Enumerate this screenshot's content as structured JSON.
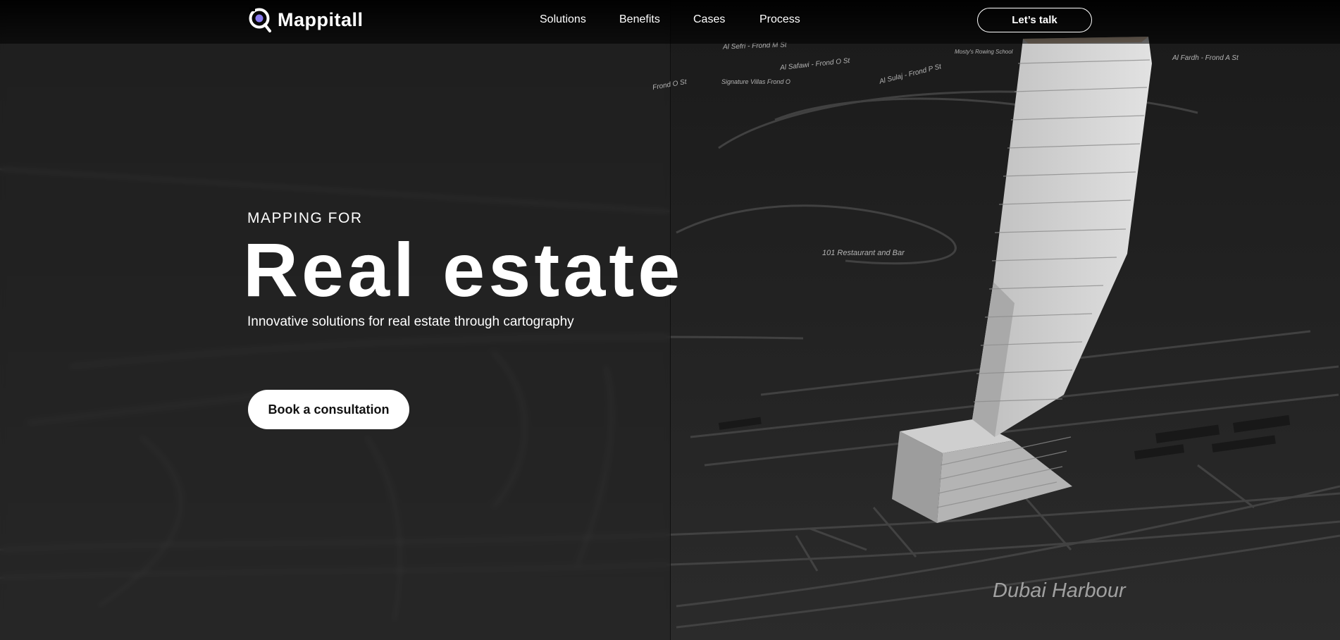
{
  "brand": {
    "name": "Mappitall"
  },
  "nav": {
    "items": [
      {
        "label": "Solutions"
      },
      {
        "label": "Benefits"
      },
      {
        "label": "Cases"
      },
      {
        "label": "Process"
      }
    ],
    "cta_label": "Let’s talk"
  },
  "hero": {
    "kicker": "MAPPING FOR",
    "headline": "Real estate",
    "subtitle": "Innovative solutions for real estate through cartography",
    "button_label": "Book a consultation"
  },
  "map": {
    "labels": [
      {
        "text": "Al Sefri - Frond M St"
      },
      {
        "text": "Al Safawi - Frond O St"
      },
      {
        "text": "Al Sulaj - Frond P St"
      },
      {
        "text": "Al Fardh - Frond A St"
      },
      {
        "text": "Signature Villas Frond O"
      },
      {
        "text": "Frond O St"
      },
      {
        "text": "Mosty's Rowing School"
      },
      {
        "text": "101 Restaurant and Bar"
      }
    ],
    "area_label": "Dubai Harbour"
  },
  "colors": {
    "background": "#1e1e1e",
    "topbar": "#000000",
    "text": "#ffffff",
    "accent": "#8a7cf0",
    "button_bg": "#ffffff",
    "button_text": "#111111"
  },
  "icons": {
    "logo": "map-pin-search-icon"
  }
}
